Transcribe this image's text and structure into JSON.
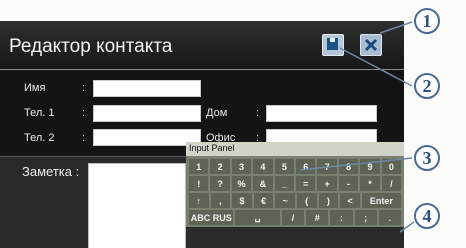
{
  "window": {
    "title": "Редактор контакта"
  },
  "toolbar": {
    "save_icon": "save-icon",
    "close_icon": "close-icon"
  },
  "form": {
    "name_label": "Имя",
    "tel1_label": "Тел. 1",
    "tel2_label": "Тел. 2",
    "home_label": "Дом",
    "office_label": "Офис",
    "colon": ":",
    "note_label": "Заметка :"
  },
  "input_panel": {
    "title": "Input Panel",
    "rows": [
      [
        "1",
        "2",
        "3",
        "4",
        "5",
        "6",
        "7",
        "8",
        "9",
        "0"
      ],
      [
        "!",
        "?",
        "%",
        "&",
        "_",
        "=",
        "+",
        "-",
        "*",
        "/"
      ],
      [
        "↑",
        ",",
        "$",
        "€",
        "~",
        "(",
        ")",
        "<",
        "Enter"
      ],
      [
        "ABC RUS",
        "␣",
        "/",
        "#",
        ":",
        ";",
        "."
      ]
    ]
  },
  "callouts": [
    "1",
    "2",
    "3",
    "4"
  ]
}
